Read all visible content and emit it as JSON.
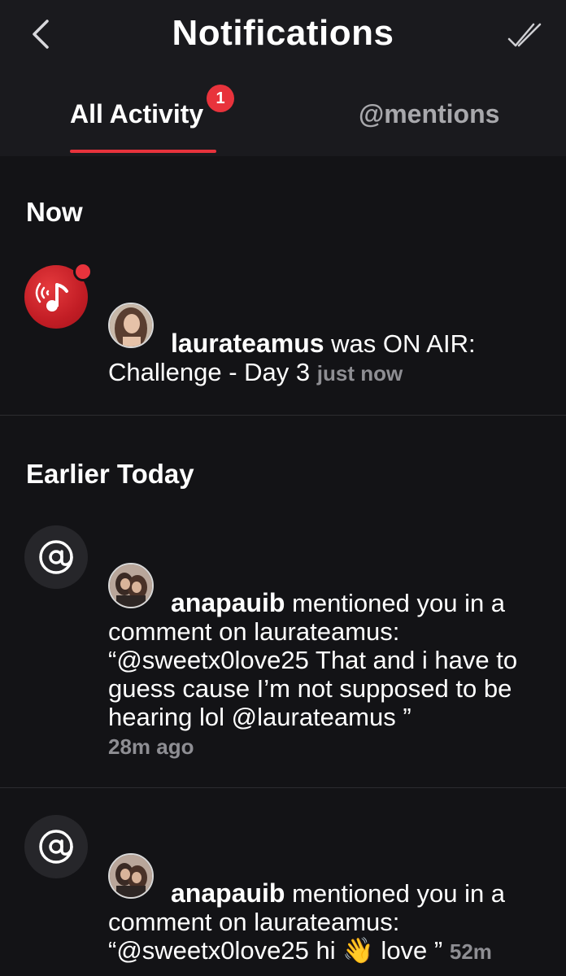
{
  "header": {
    "title": "Notifications",
    "back_icon": "chevron-left-icon",
    "mark_all_icon": "double-check-icon"
  },
  "tabs": [
    {
      "label": "All Activity",
      "badge": "1",
      "active": true
    },
    {
      "label": "@mentions",
      "active": false
    }
  ],
  "colors": {
    "accent": "#e8333c",
    "background": "#131316",
    "muted_text": "#8e8e93"
  },
  "sections": [
    {
      "title": "Now",
      "items": [
        {
          "type_icon": "on-air-music-icon",
          "unread": true,
          "user": "laurateamus",
          "text": "was ON AIR: Challenge - Day 3",
          "time": "just now"
        }
      ]
    },
    {
      "title": "Earlier Today",
      "items": [
        {
          "type_icon": "at-sign-icon",
          "user": "anapauib",
          "text": "mentioned you in a comment on laurateamus: “@sweetx0love25 That and i have to guess cause I’m not supposed to be hearing lol @laurateamus ”",
          "time": "28m ago"
        },
        {
          "type_icon": "at-sign-icon",
          "user": "anapauib",
          "text": "mentioned you in a comment on laurateamus: “@sweetx0love25 hi 👋 love ”",
          "time": "52m"
        }
      ]
    }
  ]
}
